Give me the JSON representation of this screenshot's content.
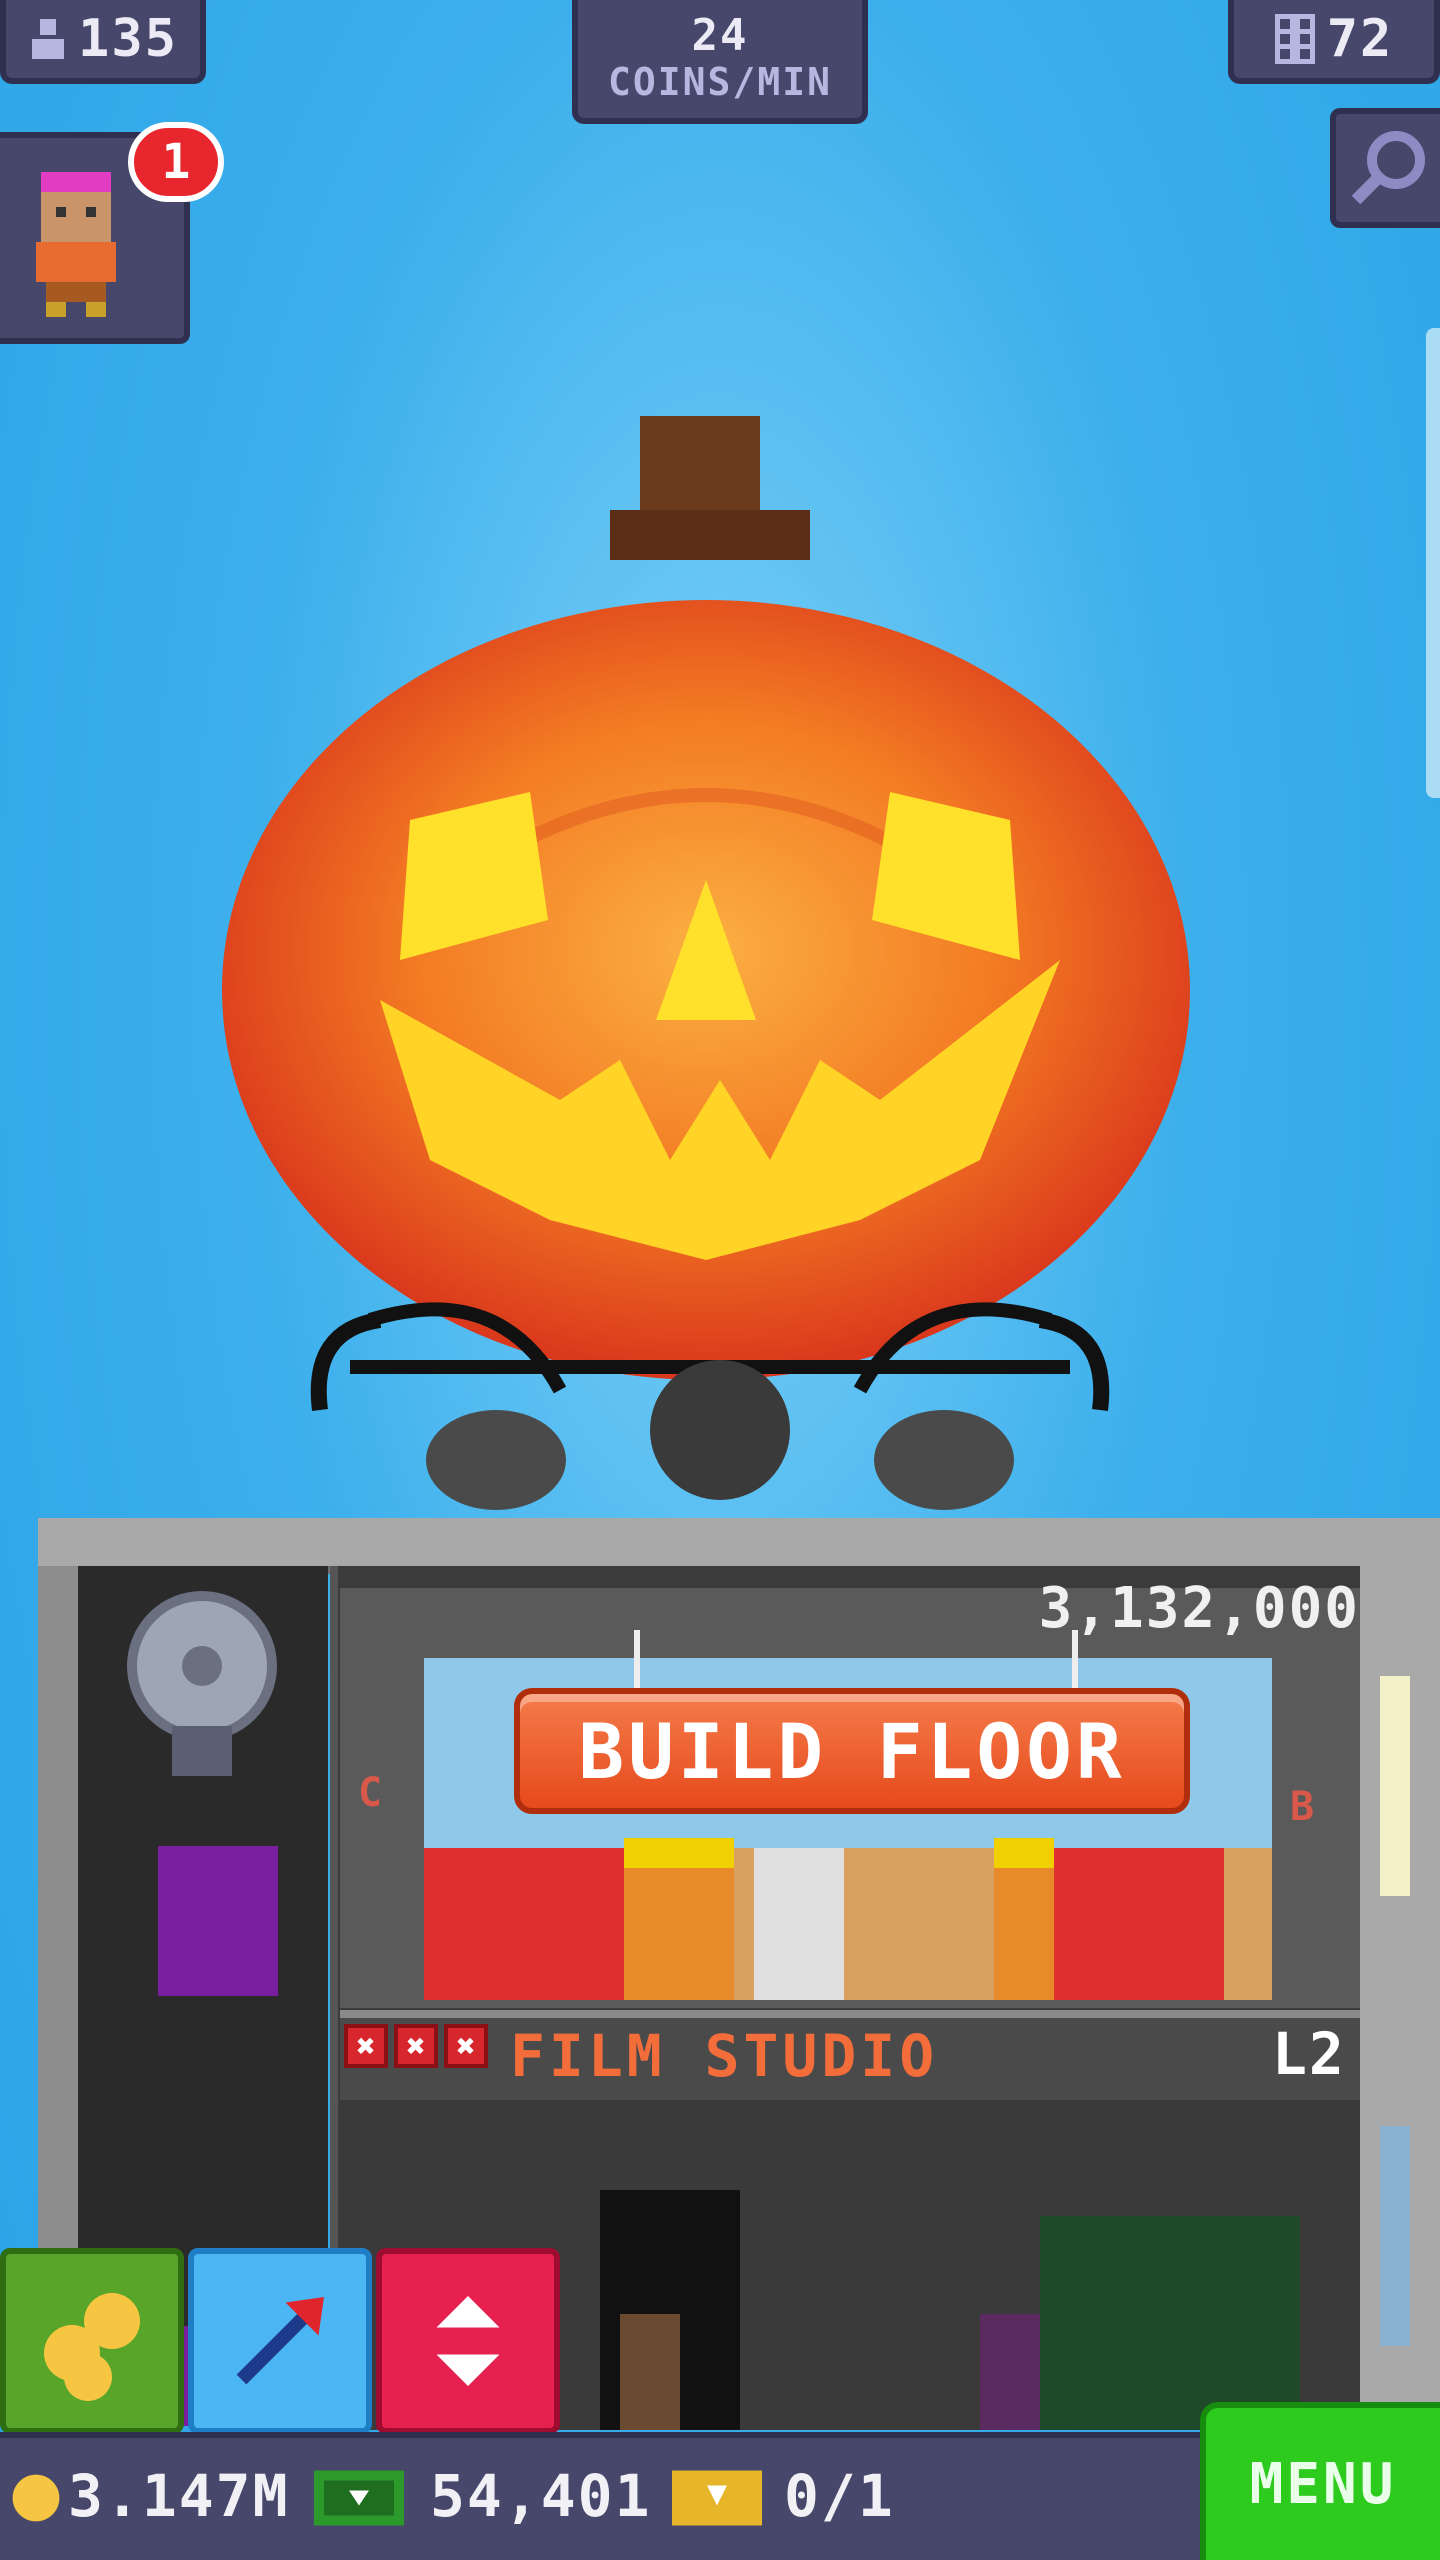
{
  "stats": {
    "population": "135",
    "coins_per_min_value": "24",
    "coins_per_min_label": "COINS/MIN",
    "floors": "72",
    "notification_count": "1"
  },
  "build": {
    "price": "3,132,000",
    "button_label": "BUILD FLOOR",
    "left_letter": "C",
    "right_letter": "B"
  },
  "floor": {
    "name": "FILM STUDIO",
    "level": "L2",
    "stars_marks": [
      "✖",
      "✖",
      "✖"
    ]
  },
  "currency": {
    "coins": "3.147M",
    "bux": "54,401",
    "tickets": "0/1"
  },
  "menu_label": "MENU",
  "icons": {
    "population": "person-icon",
    "floors": "building-icon",
    "search": "magnifier-icon",
    "coins_button": "coins-icon",
    "lift_button": "arrow-icon",
    "elevator_button": "elevator-updown-icon"
  },
  "colors": {
    "sky": "#2aa2e6",
    "panel": "#46476a",
    "build_button": "#e64a1c",
    "menu": "#2ecb1f",
    "floor_name": "#f36d3b"
  }
}
